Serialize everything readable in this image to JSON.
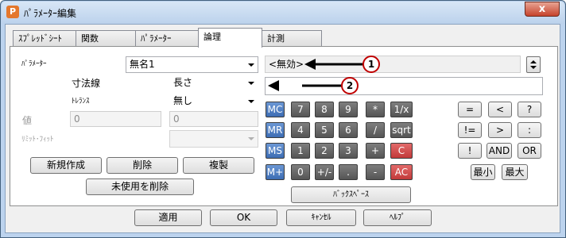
{
  "window": {
    "title": "ﾊﾟﾗﾒｰﾀｰ編集",
    "app_icon_letter": "P",
    "close_glyph": "x"
  },
  "tabs": [
    {
      "label": "ｽﾌﾟﾚｯﾄﾞｼｰﾄ"
    },
    {
      "label": "関数"
    },
    {
      "label": "ﾊﾟﾗﾒｰﾀｰ"
    },
    {
      "label": "論理"
    },
    {
      "label": "計測"
    }
  ],
  "form": {
    "parameter_label": "ﾊﾟﾗﾒｰﾀｰ",
    "parameter_value": "無名1",
    "dimension_label": "寸法線",
    "dimension_value": "長さ",
    "tolerance_label": "ﾄﾚﾗﾝｽ",
    "tolerance_value": "無し",
    "value_label": "値",
    "value_left": "0",
    "value_right": "0",
    "limit_fit_label": "ﾘﾐｯﾄ･ﾌｨｯﾄ",
    "limit_fit_value": ""
  },
  "actions": {
    "new": "新規作成",
    "delete": "削除",
    "duplicate": "複製",
    "delete_unused": "未使用を削除"
  },
  "expression": {
    "line1": "<無効>",
    "line2": ""
  },
  "annotations": {
    "badge1": "1",
    "badge2": "2"
  },
  "calculator": {
    "rows": [
      [
        "MC",
        "7",
        "8",
        "9",
        "*",
        "1/x"
      ],
      [
        "MR",
        "4",
        "5",
        "6",
        "/",
        "sqrt"
      ],
      [
        "MS",
        "1",
        "2",
        "3",
        "+",
        "C"
      ],
      [
        "M+",
        "0",
        "+/-",
        ".",
        "-",
        "AC"
      ]
    ],
    "backspace": "ﾊﾞｯｸｽﾍﾟｰｽ"
  },
  "logic": {
    "row1": [
      "=",
      "<",
      "?"
    ],
    "row2": [
      "!=",
      ">",
      ":"
    ],
    "row3": [
      "!",
      "AND",
      "OR"
    ],
    "row4": [
      "最小",
      "最大"
    ]
  },
  "footer": {
    "apply": "適用",
    "ok": "OK",
    "cancel": "ｷｬﾝｾﾙ",
    "help": "ﾍﾙﾌﾟ"
  }
}
